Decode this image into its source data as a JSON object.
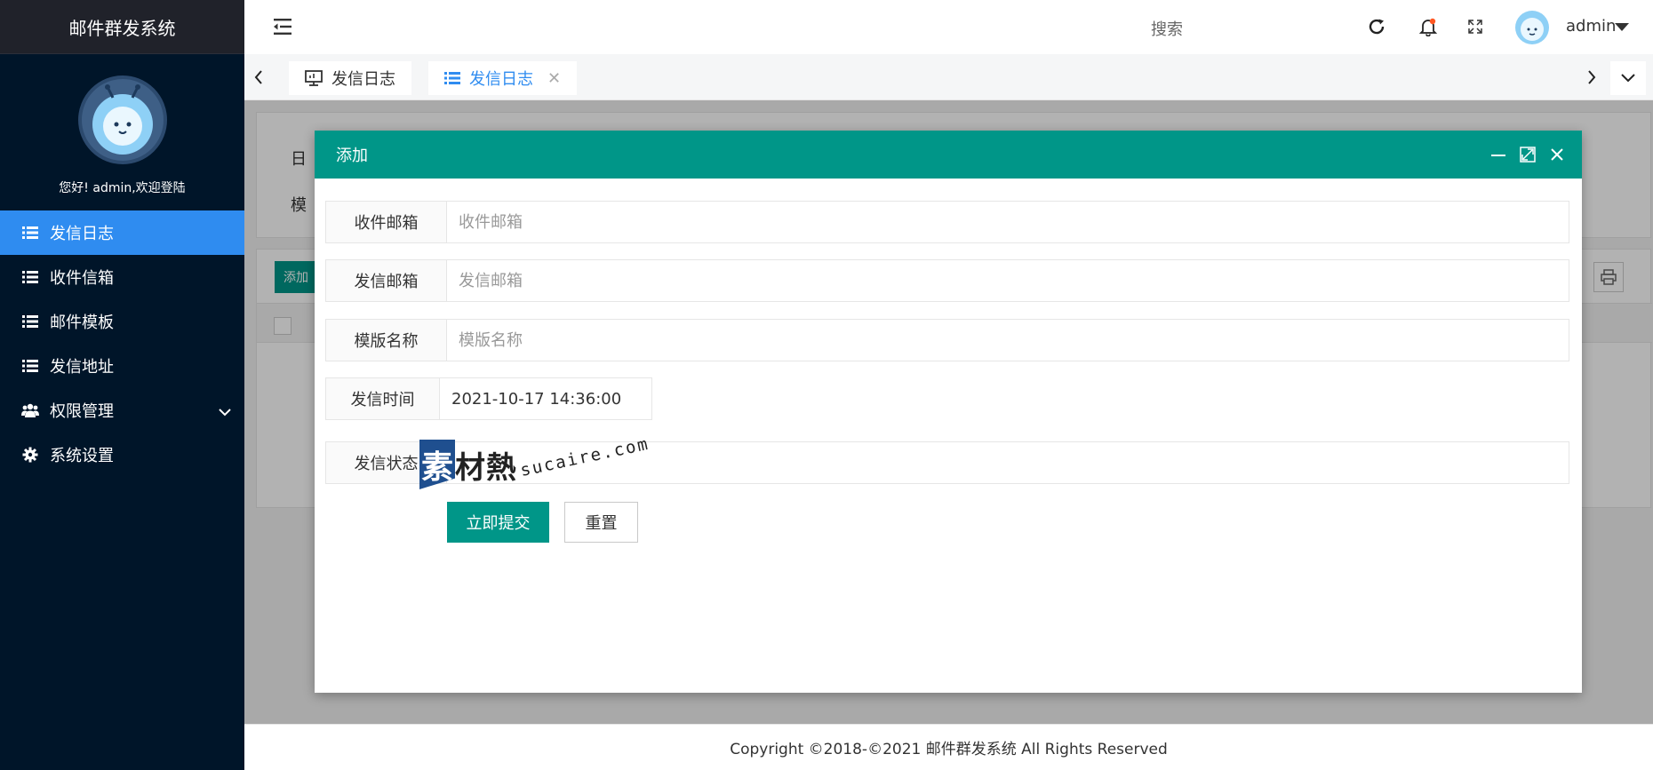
{
  "app": {
    "title": "邮件群发系统"
  },
  "sidebar": {
    "welcome": "您好! admin,欢迎登陆",
    "items": [
      {
        "label": "发信日志",
        "icon": "list-icon",
        "active": true
      },
      {
        "label": "收件信箱",
        "icon": "list-icon"
      },
      {
        "label": "邮件模板",
        "icon": "list-icon"
      },
      {
        "label": "发信地址",
        "icon": "list-icon"
      },
      {
        "label": "权限管理",
        "icon": "users-icon",
        "expandable": true
      },
      {
        "label": "系统设置",
        "icon": "gear-icon"
      }
    ]
  },
  "header": {
    "search_label": "搜索",
    "username": "admin",
    "icons": [
      "menu-fold-icon",
      "refresh-icon",
      "bell-icon",
      "fullscreen-icon"
    ]
  },
  "tabs": [
    {
      "label": "发信日志",
      "icon": "monitor-icon"
    },
    {
      "label": "发信日志",
      "icon": "list-icon",
      "active": true,
      "closable": true
    }
  ],
  "background_page": {
    "filter_labels": [
      "日",
      "模"
    ],
    "add_button": "添加"
  },
  "modal": {
    "title": "添加",
    "fields": [
      {
        "label": "收件邮箱",
        "placeholder": "收件邮箱",
        "value": ""
      },
      {
        "label": "发信邮箱",
        "placeholder": "发信邮箱",
        "value": ""
      },
      {
        "label": "模版名称",
        "placeholder": "模版名称",
        "value": ""
      },
      {
        "label": "发信时间",
        "placeholder": "",
        "value": "2021-10-17 14:36:00"
      },
      {
        "label": "发信状态",
        "placeholder": "",
        "value": ""
      }
    ],
    "submit_label": "立即提交",
    "reset_label": "重置"
  },
  "watermark": {
    "badge": "素",
    "text": "材熱",
    "url": "sucaire.com"
  },
  "footer": {
    "copyright": "Copyright ©2018-©2021 邮件群发系统 All Rights Reserved"
  },
  "colors": {
    "sidebar_bg": "#001529",
    "active_menu": "#2f8cf0",
    "primary": "#009688",
    "modal_header": "#009688"
  }
}
